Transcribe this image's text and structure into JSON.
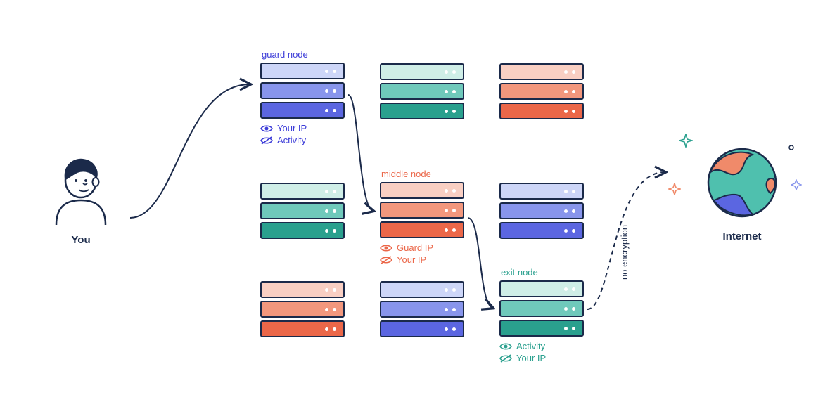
{
  "person": {
    "label": "You"
  },
  "internet": {
    "label": "Internet"
  },
  "no_encryption_label": "no encryption",
  "columns": {
    "guard": {
      "title": "guard node",
      "title_color": "#3c3cd8",
      "visible": {
        "label": "Your IP"
      },
      "hidden": {
        "label": "Activity"
      },
      "sight_color": "#3c3cd8",
      "row1": {
        "colors": [
          "#cdd6f8",
          "#8895ec",
          "#5b66e1"
        ]
      },
      "row2": {
        "colors": [
          "#cfeee7",
          "#6fc9bb",
          "#2aa08e"
        ]
      },
      "row3": {
        "colors": [
          "#f9cfc3",
          "#f2977d",
          "#eb6749"
        ]
      }
    },
    "middle": {
      "title": "middle node",
      "title_color": "#eb6749",
      "visible": {
        "label": "Guard IP"
      },
      "hidden": {
        "label": "Your IP"
      },
      "sight_color": "#eb6749",
      "row1": {
        "colors": [
          "#cfeee7",
          "#6fc9bb",
          "#2aa08e"
        ]
      },
      "row2": {
        "colors": [
          "#f9cfc3",
          "#f2977d",
          "#eb6749"
        ]
      },
      "row3": {
        "colors": [
          "#cdd6f8",
          "#8895ec",
          "#5b66e1"
        ]
      }
    },
    "exit": {
      "title": "exit node",
      "title_color": "#2aa08e",
      "visible": {
        "label": "Activity"
      },
      "hidden": {
        "label": "Your IP"
      },
      "sight_color": "#2aa08e",
      "row1": {
        "colors": [
          "#f9cfc3",
          "#f2977d",
          "#eb6749"
        ]
      },
      "row2": {
        "colors": [
          "#cdd6f8",
          "#8895ec",
          "#5b66e1"
        ]
      },
      "row3": {
        "colors": [
          "#cfeee7",
          "#6fc9bb",
          "#2aa08e"
        ]
      }
    }
  }
}
